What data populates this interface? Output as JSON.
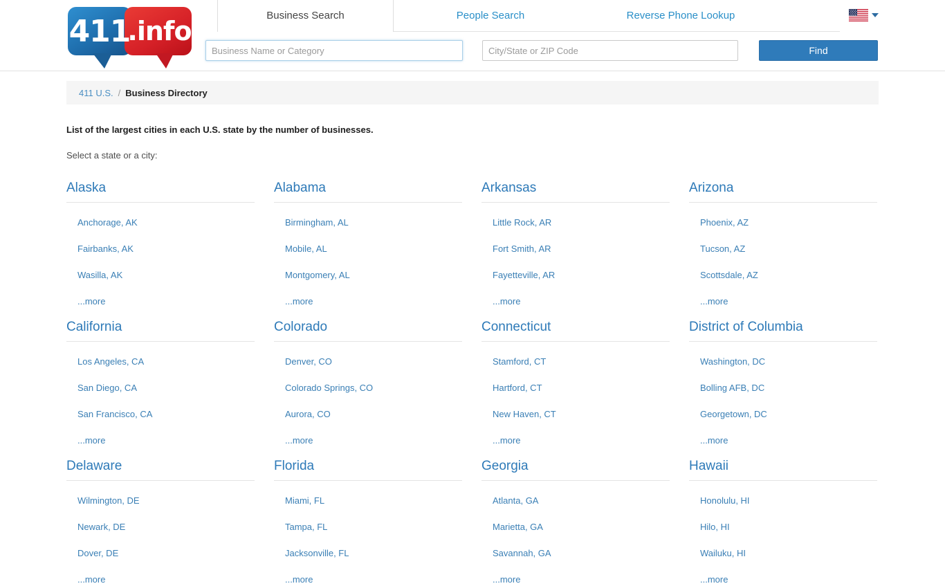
{
  "header": {
    "logo": {
      "part1": "411",
      "part2": ".info",
      "alt": "411.info logo"
    },
    "tabs": [
      {
        "label": "Business Search",
        "active": true
      },
      {
        "label": "People Search",
        "active": false
      },
      {
        "label": "Reverse Phone Lookup",
        "active": false
      }
    ],
    "locale": {
      "flag": "us-flag-icon",
      "caret": "chevron-down-icon"
    },
    "search": {
      "business_value": "",
      "business_placeholder": "Business Name or Category",
      "location_value": "",
      "location_placeholder": "City/State or ZIP Code",
      "find_label": "Find"
    }
  },
  "breadcrumb": {
    "home": "411 U.S.",
    "separator": "/",
    "current": "Business Directory"
  },
  "main": {
    "title": "List of the largest cities in each U.S. state by the number of businesses.",
    "subtitle": "Select a state or a city:",
    "more_label": "...more",
    "states": [
      {
        "name": "Alaska",
        "cities": [
          "Anchorage, AK",
          "Fairbanks, AK",
          "Wasilla, AK"
        ],
        "more": "...more"
      },
      {
        "name": "Alabama",
        "cities": [
          "Birmingham, AL",
          "Mobile, AL",
          "Montgomery, AL"
        ],
        "more": "...more"
      },
      {
        "name": "Arkansas",
        "cities": [
          "Little Rock, AR",
          "Fort Smith, AR",
          "Fayetteville, AR"
        ],
        "more": "...more"
      },
      {
        "name": "Arizona",
        "cities": [
          "Phoenix, AZ",
          "Tucson, AZ",
          "Scottsdale, AZ"
        ],
        "more": "...more"
      },
      {
        "name": "California",
        "cities": [
          "Los Angeles, CA",
          "San Diego, CA",
          "San Francisco, CA"
        ],
        "more": "...more"
      },
      {
        "name": "Colorado",
        "cities": [
          "Denver, CO",
          "Colorado Springs, CO",
          "Aurora, CO"
        ],
        "more": "...more"
      },
      {
        "name": "Connecticut",
        "cities": [
          "Stamford, CT",
          "Hartford, CT",
          "New Haven, CT"
        ],
        "more": "...more"
      },
      {
        "name": "District of Columbia",
        "cities": [
          "Washington, DC",
          "Bolling AFB, DC",
          "Georgetown, DC"
        ],
        "more": "...more"
      },
      {
        "name": "Delaware",
        "cities": [
          "Wilmington, DE",
          "Newark, DE",
          "Dover, DE"
        ],
        "more": "...more"
      },
      {
        "name": "Florida",
        "cities": [
          "Miami, FL",
          "Tampa, FL",
          "Jacksonville, FL"
        ],
        "more": "...more"
      },
      {
        "name": "Georgia",
        "cities": [
          "Atlanta, GA",
          "Marietta, GA",
          "Savannah, GA"
        ],
        "more": "...more"
      },
      {
        "name": "Hawaii",
        "cities": [
          "Honolulu, HI",
          "Hilo, HI",
          "Wailuku, HI"
        ],
        "more": "...more"
      }
    ]
  },
  "colors": {
    "brand_blue": "#1f6fae",
    "brand_red": "#d52027",
    "link_blue": "#3a7fb5",
    "heading_blue": "#2e7ab8",
    "tab_blue": "#2a8fc8",
    "button_blue": "#2f7bba",
    "breadcrumb_bg": "#f5f5f5"
  }
}
